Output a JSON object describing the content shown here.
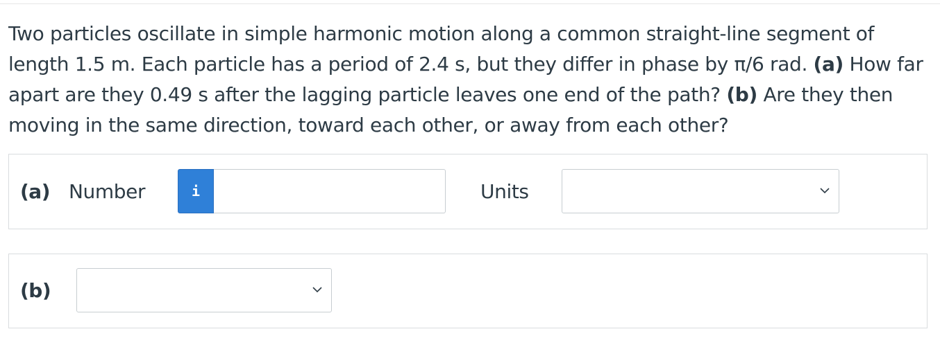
{
  "question": {
    "line1": "Two particles oscillate in simple harmonic motion along a common straight-line segment of",
    "line2_pre": "length 1.5 m. Each particle has a period of 2.4 s, but they differ in phase by π/6 rad. ",
    "line2_bold": "(a)",
    "line2_post": " How far",
    "line3_pre": "apart are they 0.49 s after the lagging particle leaves one end of the path? ",
    "line3_bold": "(b)",
    "line3_post": " Are they then",
    "line4": "moving in the same direction, toward each other, or away from each other?"
  },
  "part_a": {
    "label": "(a)",
    "number_label": "Number",
    "info_icon_glyph": "i",
    "number_value": "",
    "units_label": "Units",
    "units_selected": ""
  },
  "part_b": {
    "label": "(b)",
    "selected": ""
  },
  "colors": {
    "info_button": "#2f80d8",
    "text": "#2d3b45",
    "border": "#d9dcde"
  }
}
